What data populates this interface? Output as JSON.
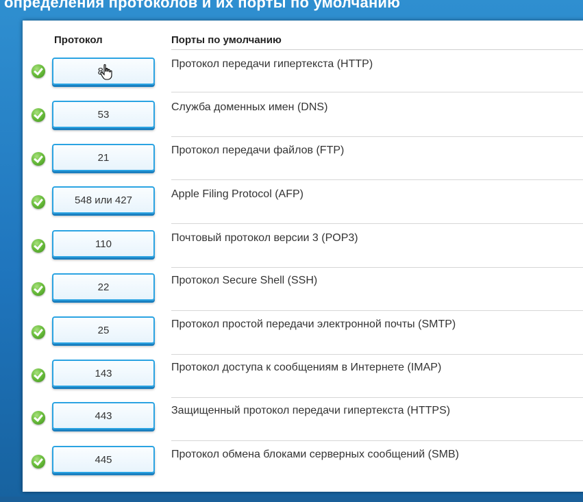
{
  "heading": "определения протоколов и их порты по умолчанию",
  "columns": {
    "protocol": "Протокол",
    "default_ports": "Порты по умолчанию"
  },
  "rows": [
    {
      "port": "80",
      "description": "Протокол передачи гипертекста (HTTP)",
      "status": "correct"
    },
    {
      "port": "53",
      "description": "Служба доменных имен (DNS)",
      "status": "correct"
    },
    {
      "port": "21",
      "description": "Протокол передачи файлов (FTP)",
      "status": "correct"
    },
    {
      "port": "548 или 427",
      "description": "Apple Filing Protocol (AFP)",
      "status": "correct"
    },
    {
      "port": "110",
      "description": "Почтовый протокол версии 3 (POP3)",
      "status": "correct"
    },
    {
      "port": "22",
      "description": "Протокол Secure Shell (SSH)",
      "status": "correct"
    },
    {
      "port": "25",
      "description": "Протокол простой передачи электронной почты (SMTP)",
      "status": "correct"
    },
    {
      "port": "143",
      "description": "Протокол доступа к сообщениям в Интернете (IMAP)",
      "status": "correct"
    },
    {
      "port": "443",
      "description": "Защищенный протокол передачи гипертекста (HTTPS)",
      "status": "correct"
    },
    {
      "port": "445",
      "description": "Протокол обмена блоками серверных сообщений (SMB)",
      "status": "correct"
    }
  ],
  "icons": {
    "status": "check-circle-icon",
    "cursor": "hand-pointer-icon"
  },
  "colors": {
    "background": "#1f75bd",
    "check": "#5bb131",
    "port_border": "#2aa3e2"
  }
}
